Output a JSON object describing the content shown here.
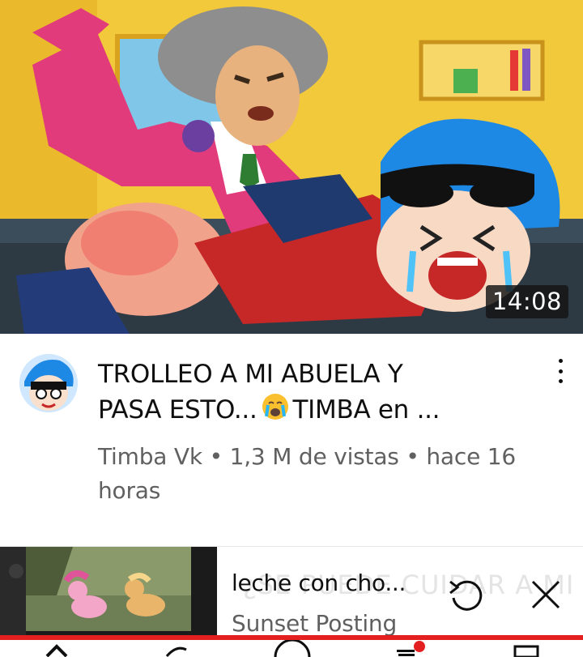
{
  "video": {
    "duration": "14:08",
    "title_line1": "TROLLEO A MI ABUELA Y",
    "title_line2_pre": "PASA ESTO...",
    "title_line2_post": "TIMBA en ...",
    "title_emoji": "crying-face",
    "meta": "Timba Vk • 1,3 M de vistas • hace 16 horas",
    "channel_avatar": "timba-vk-avatar"
  },
  "mini_player": {
    "title": "leche con cho...",
    "channel": "Sunset Posting",
    "background_text": "¿SE PUEDE CUIDAR A MI HIJA?",
    "replay_icon": "replay-icon",
    "close_icon": "close-icon"
  },
  "bottom_nav": {
    "items": [
      "home-icon",
      "shorts-icon",
      "create-icon",
      "subscriptions-icon",
      "library-icon"
    ]
  },
  "colors": {
    "title_text": "#0f0f0f",
    "meta_text": "#606060",
    "progress_red": "#e41f1f",
    "duration_bg": "#141414"
  }
}
